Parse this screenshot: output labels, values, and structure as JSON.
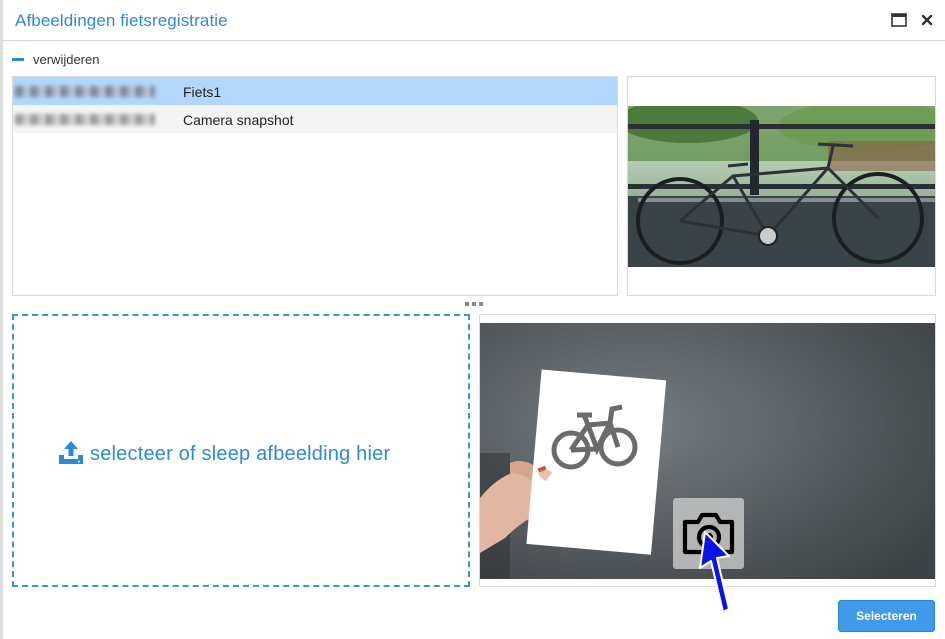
{
  "dialog": {
    "title": "Afbeeldingen fietsregistratie",
    "maximize_icon": "window-maximize-icon",
    "close_icon": "close-icon"
  },
  "actions": {
    "remove_label": "verwijderen",
    "remove_icon": "minus-icon"
  },
  "image_list": {
    "rows": [
      {
        "date": "",
        "name": "Fiets1",
        "selected": true
      },
      {
        "date": "",
        "name": "Camera snapshot",
        "selected": false
      }
    ]
  },
  "dropzone": {
    "icon": "upload-icon",
    "text": "selecteer of sleep afbeelding hier"
  },
  "camera": {
    "snapshot_icon": "camera-icon"
  },
  "footer": {
    "select_label": "Selecteren"
  },
  "colors": {
    "accent": "#2e8ad8",
    "selected_row": "#b3d7fb",
    "button": "#3d9be9",
    "pointer_arrow": "#0a14e6"
  }
}
